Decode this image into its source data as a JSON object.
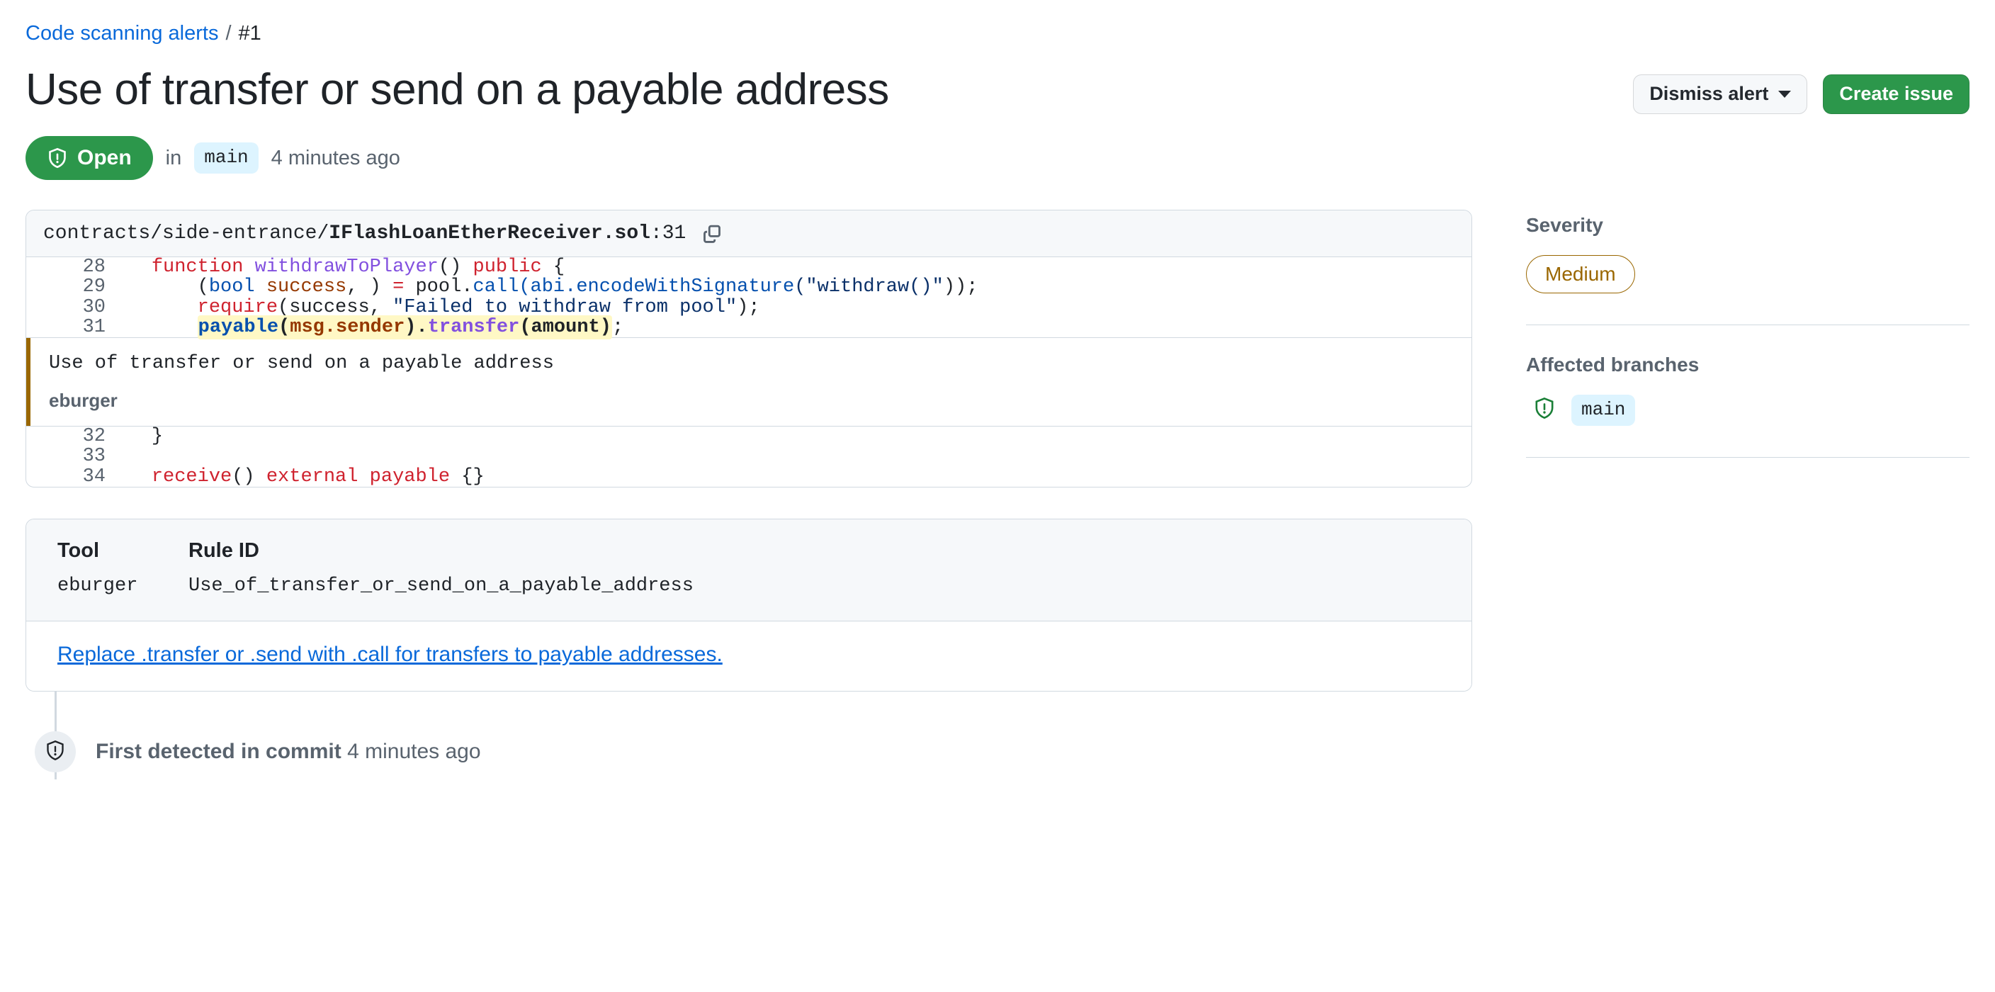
{
  "breadcrumb": {
    "parent_label": "Code scanning alerts",
    "separator": "/",
    "current_label": "#1"
  },
  "header": {
    "title": "Use of transfer or send on a payable address",
    "dismiss_label": "Dismiss alert",
    "create_issue_label": "Create issue"
  },
  "status": {
    "state_label": "Open",
    "in_label": "in",
    "branch": "main",
    "time_label": "4 minutes ago"
  },
  "snippet": {
    "path_prefix": "contracts/side-entrance/",
    "file_name": "IFlashLoanEtherReceiver.sol",
    "line_suffix": ":31",
    "copy_icon": "copy-icon",
    "lines": [
      {
        "number": "28"
      },
      {
        "number": "29"
      },
      {
        "number": "30"
      },
      {
        "number": "31"
      },
      {
        "number": "32"
      },
      {
        "number": "33"
      },
      {
        "number": "34"
      }
    ],
    "code": {
      "l28_k_function": "function",
      "l28_fn": "withdrawToPlayer",
      "l28_parens": "()",
      "l28_k_public": "public",
      "l28_brace": "{",
      "l29_open": "(",
      "l29_ty": "bool",
      "l29_va": "success",
      "l29_close": ", ) ",
      "l29_eq": "=",
      "l29_pool": " pool.",
      "l29_call": "call",
      "l29_abi": "(abi.encodeWithSignature",
      "l29_str": "(\"withdraw()\"",
      "l29_end": "));",
      "l30_require": "require",
      "l30_args": "(success, ",
      "l30_str": "\"Failed to withdraw from pool\"",
      "l30_end": ");",
      "l31_payable": "payable",
      "l31_open": "(",
      "l31_msgsender": "msg.sender",
      "l31_dot": ").",
      "l31_transfer": "transfer",
      "l31_amount": "(amount)",
      "l31_semi": ";",
      "l32": "}",
      "l33": "",
      "l34_receive": "receive",
      "l34_parens": "() ",
      "l34_external": "external",
      "l34_payable": "payable",
      "l34_braces": " {}"
    },
    "annotation": {
      "message": "Use of transfer or send on a payable address",
      "tool": "eburger"
    }
  },
  "tool_table": {
    "header_tool": "Tool",
    "header_rule": "Rule ID",
    "tool_value": "eburger",
    "rule_value": "Use_of_transfer_or_send_on_a_payable_address",
    "help_link": "Replace .transfer or .send with .call for transfers to payable addresses."
  },
  "timeline": {
    "event_label": "First detected in commit",
    "event_time": "4 minutes ago"
  },
  "sidebar": {
    "severity_heading": "Severity",
    "severity_value": "Medium",
    "branches_heading": "Affected branches",
    "branch_name": "main"
  },
  "colors": {
    "open_green": "#2c974b",
    "link_blue": "#0969da",
    "severity_amber": "#9a6700",
    "branch_chip_bg": "#ddf4ff",
    "highlight_yellow": "#fff8c5",
    "shield_green": "#1a7f37"
  }
}
